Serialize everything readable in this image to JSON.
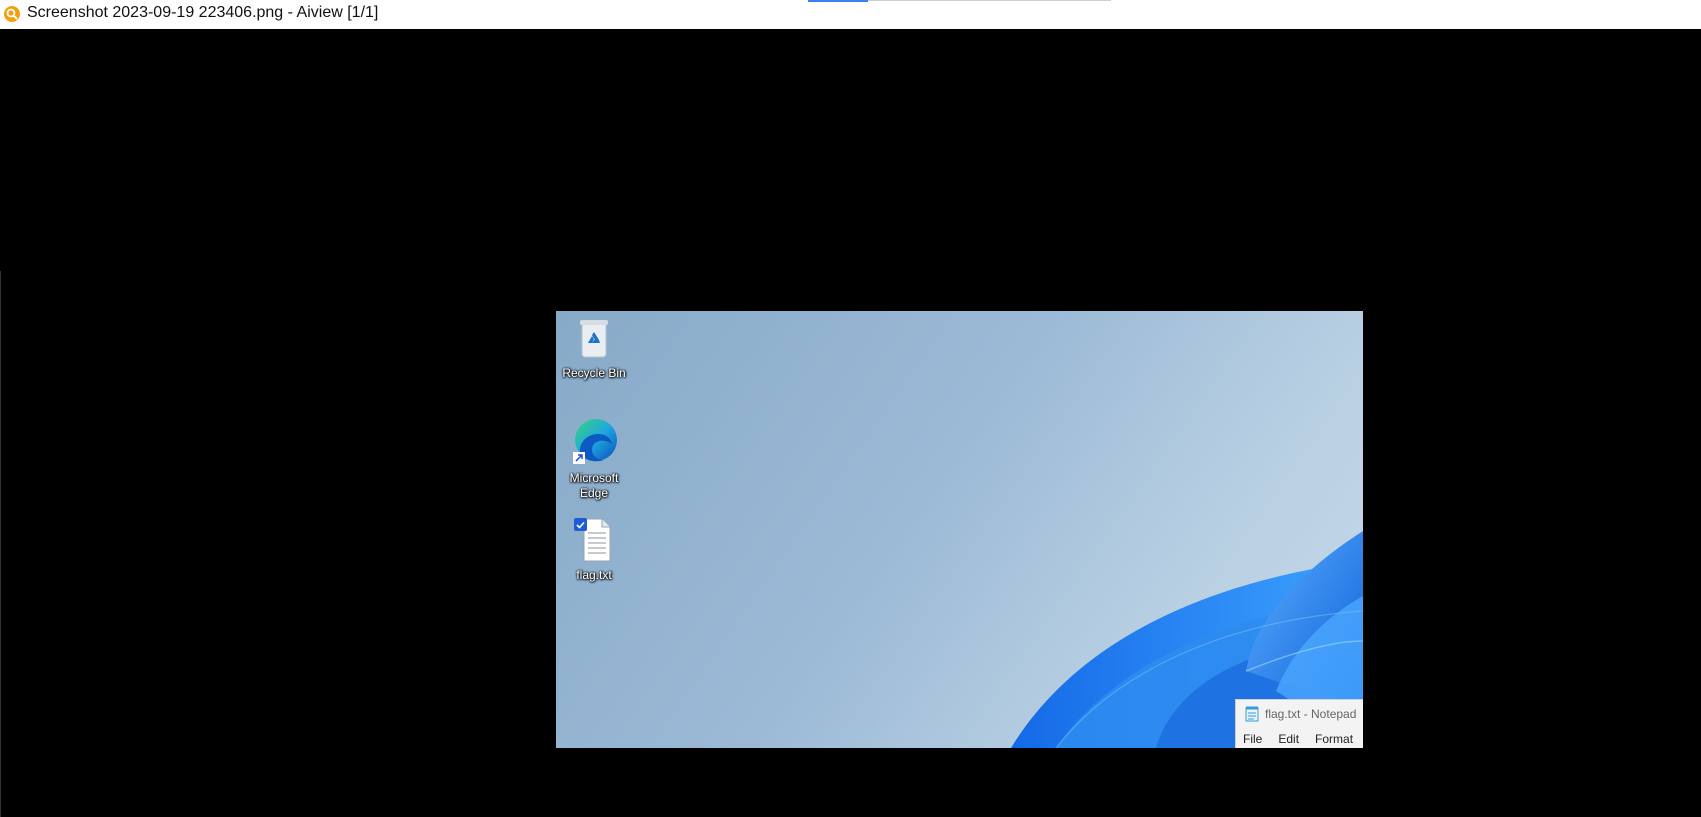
{
  "window": {
    "title": "Screenshot 2023-09-19 223406.png - Aiview [1/1]"
  },
  "desktop": {
    "icons": [
      {
        "label": "Recycle Bin",
        "icon": "recycle-bin-icon"
      },
      {
        "label": "Microsoft Edge",
        "icon": "edge-icon"
      },
      {
        "label": "flag.txt",
        "icon": "text-file-icon"
      }
    ]
  },
  "notepad": {
    "title": "flag.txt - Notepad",
    "menu": [
      "File",
      "Edit",
      "Format"
    ]
  },
  "colors": {
    "accent": "#3b82f6",
    "viewer_background": "#000000",
    "wallpaper": "#9cbad6",
    "bloom": "#1f7ae0"
  }
}
